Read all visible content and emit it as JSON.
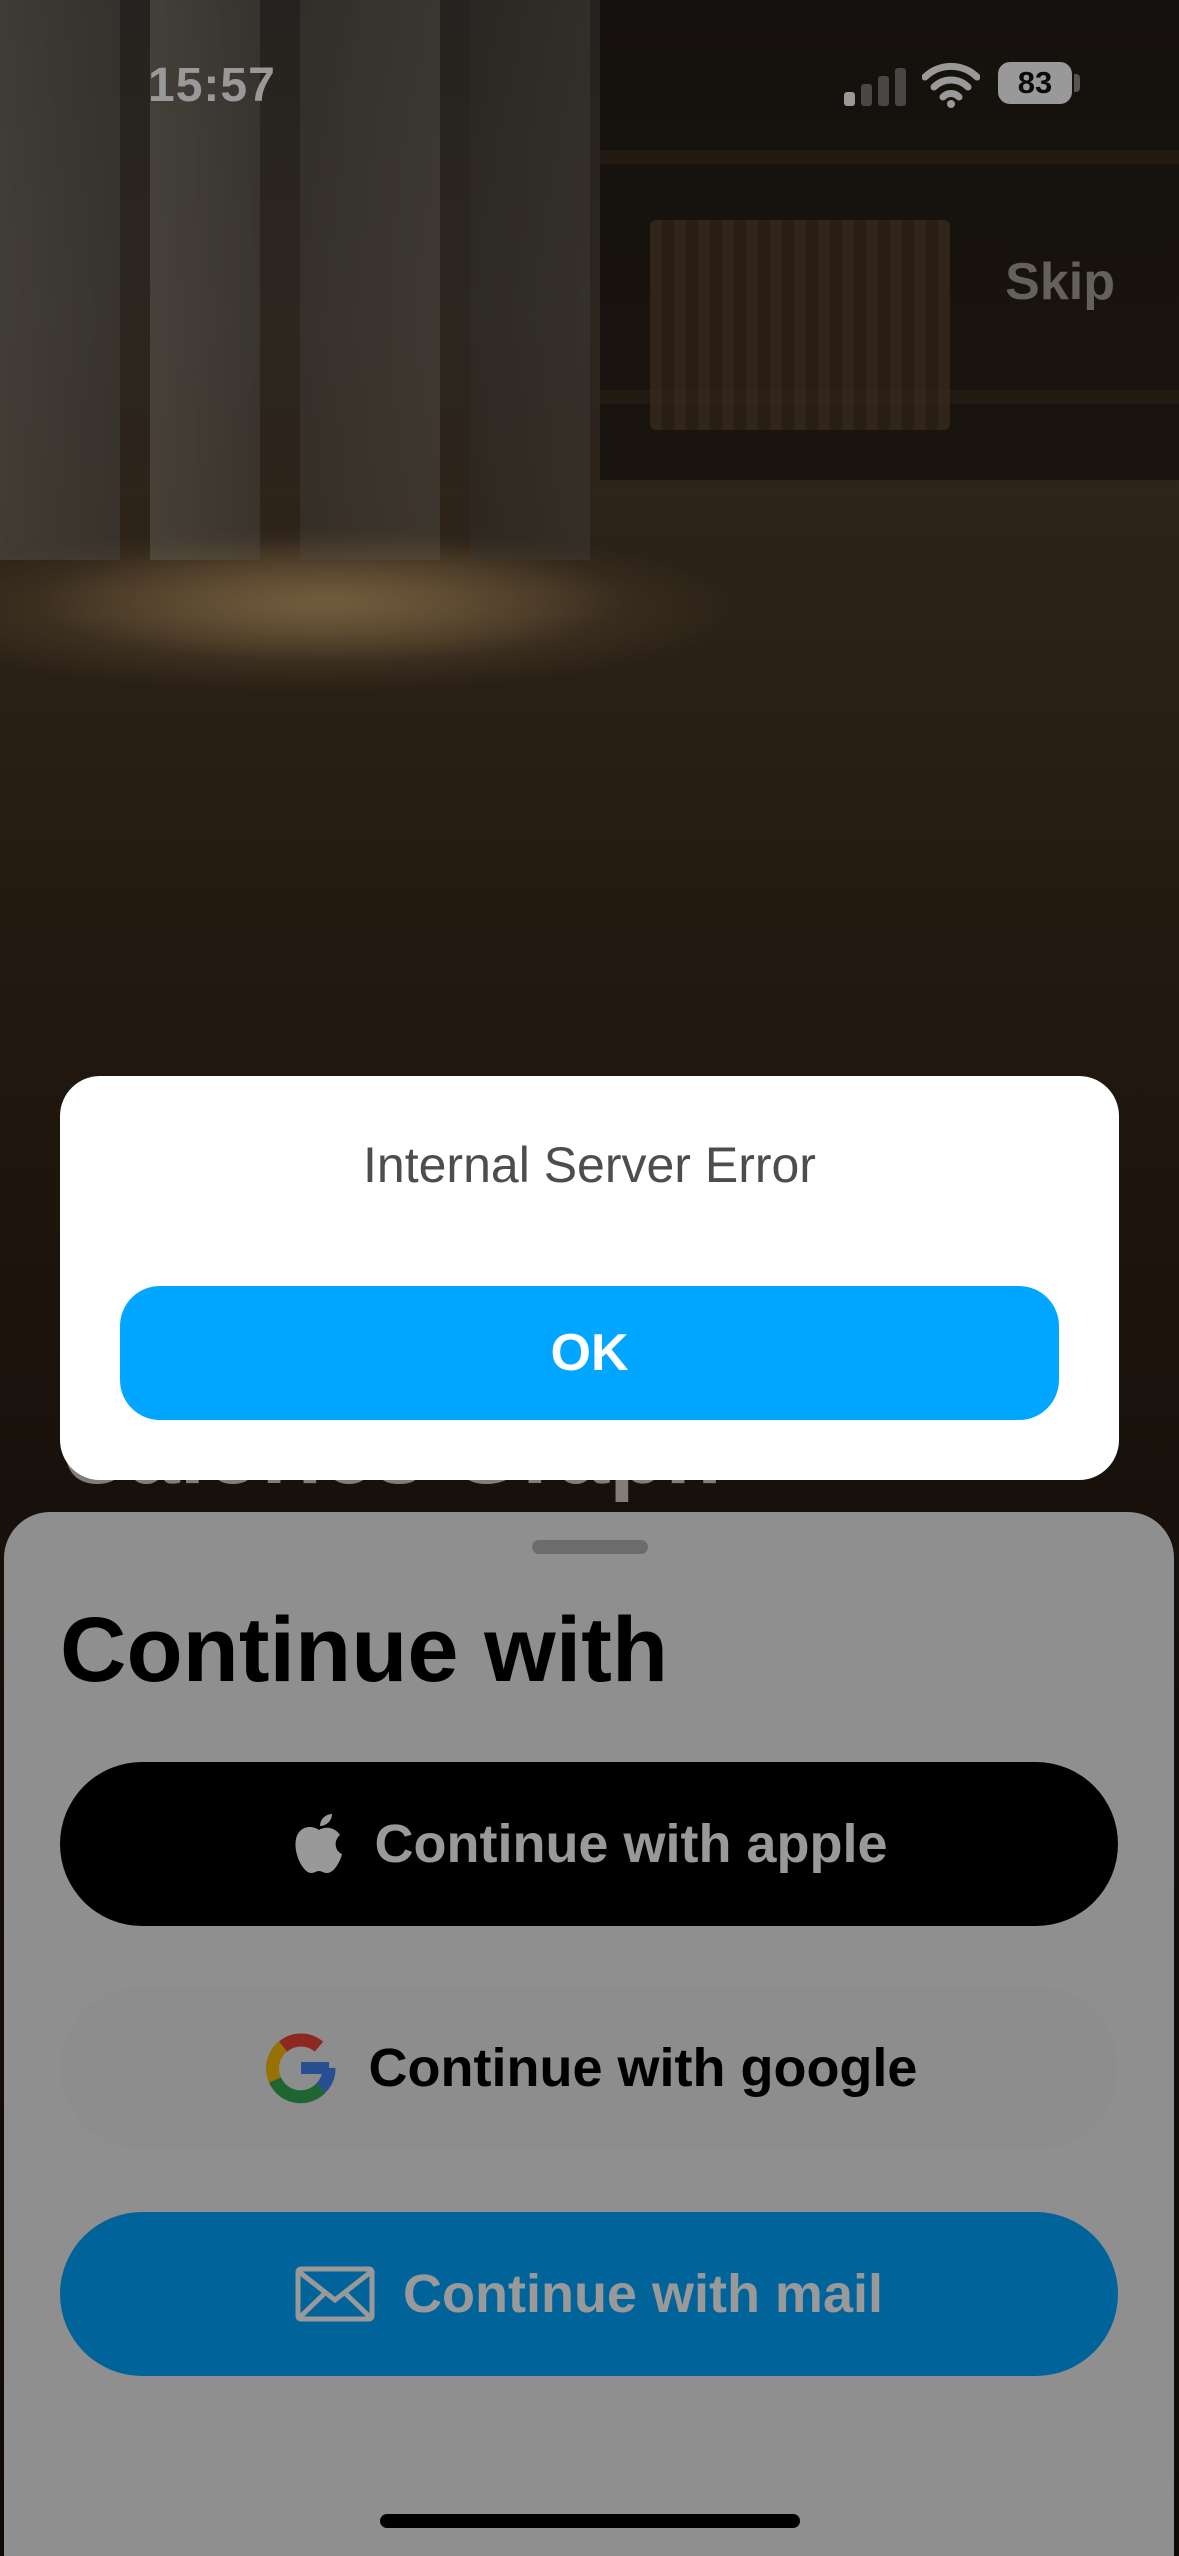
{
  "status_bar": {
    "time": "15:57",
    "battery": "83"
  },
  "header": {
    "skip_label": "Skip"
  },
  "background": {
    "title_partial": "Calories Graph"
  },
  "sheet": {
    "heading": "Continue with",
    "buttons": [
      {
        "label": "Continue with apple",
        "icon": "apple-icon"
      },
      {
        "label": "Continue with google",
        "icon": "google-icon"
      },
      {
        "label": "Continue with mail",
        "icon": "mail-icon"
      }
    ]
  },
  "alert": {
    "message": "Internal Server Error",
    "ok_label": "OK"
  },
  "colors": {
    "accent_blue": "#00a6ff",
    "apple_button": "#000000",
    "google_button": "#ececec",
    "sheet_background": "#eeeeee"
  }
}
